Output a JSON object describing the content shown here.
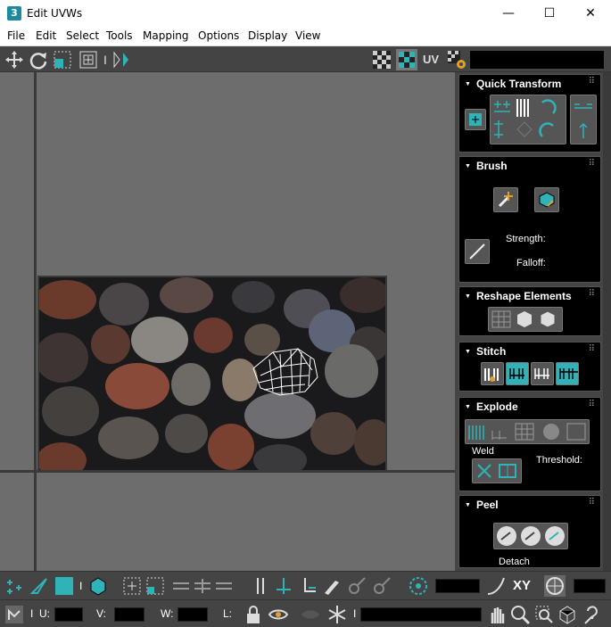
{
  "window": {
    "app_icon": "3",
    "title": "Edit UVWs",
    "minimize": "—",
    "maximize": "☐",
    "close": "✕"
  },
  "menu": [
    "File",
    "Edit",
    "Select",
    "Tools",
    "Mapping",
    "Options",
    "Display",
    "View"
  ],
  "toolbar": {
    "uv_label": "UV",
    "icons": [
      "move-icon",
      "rotate-icon",
      "scale-icon",
      "freeform-icon",
      "mirror-icon",
      "checker-icon",
      "checker-active-icon",
      "uv-space-icon",
      "settings-icon"
    ]
  },
  "rollouts": {
    "quick_transform": {
      "title": "Quick Transform"
    },
    "brush": {
      "title": "Brush",
      "strength_label": "Strength:",
      "falloff_label": "Falloff:"
    },
    "reshape": {
      "title": "Reshape Elements"
    },
    "stitch": {
      "title": "Stitch"
    },
    "explode": {
      "title": "Explode",
      "weld_label": "Weld",
      "threshold_label": "Threshold:"
    },
    "peel": {
      "title": "Peel",
      "detach_label": "Detach"
    }
  },
  "bottom": {
    "xy_label": "XY",
    "u_label": "U:",
    "v_label": "V:",
    "w_label": "W:",
    "l_label": "L:",
    "i_label": "I",
    "sep": "I"
  },
  "colors": {
    "accent": "#2fb3b8",
    "panel": "#000000",
    "viewport": "#6d6d6d",
    "toolbar": "#444444"
  }
}
